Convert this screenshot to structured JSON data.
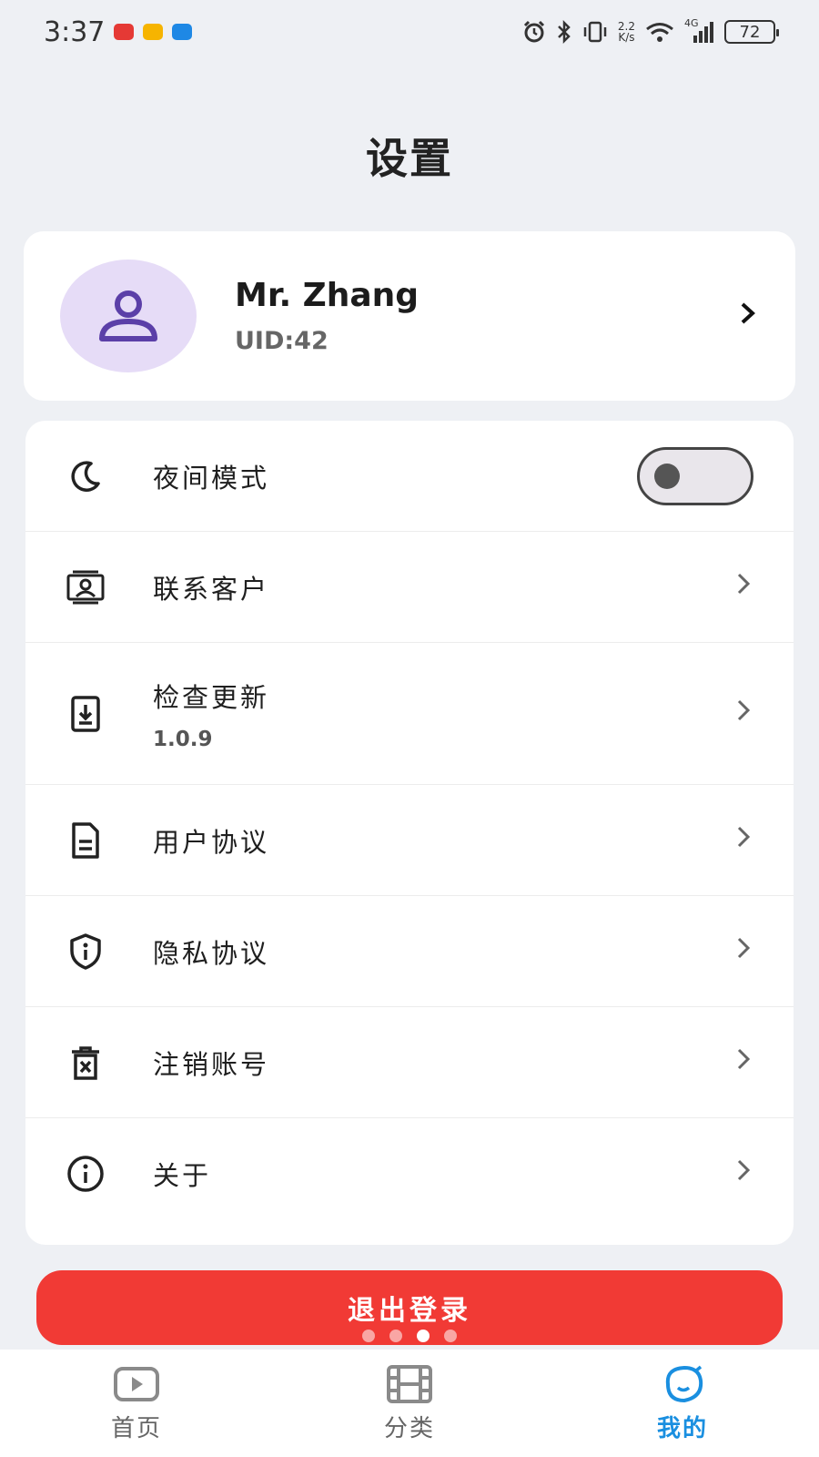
{
  "status_bar": {
    "time": "3:37",
    "net_speed_top": "2.2",
    "net_speed_bottom": "K/s",
    "network_type": "4G",
    "battery": "72",
    "app_icons": [
      "huawei-app-icon",
      "mail-app-icon",
      "message-app-icon"
    ],
    "app_icon_colors": [
      "#e53935",
      "#f6b400",
      "#1e88e5"
    ]
  },
  "page": {
    "title": "设置"
  },
  "profile": {
    "name": "Mr. Zhang",
    "uid": "UID:42",
    "avatar_color": "#e6dcf7",
    "avatar_icon_color": "#5b3fa8"
  },
  "settings": {
    "items": [
      {
        "label": "夜间模式",
        "icon": "moon-icon",
        "control": "toggle",
        "toggle_on": false
      },
      {
        "label": "联系客户",
        "icon": "contact-card-icon",
        "control": "chevron"
      },
      {
        "label": "检查更新",
        "sub": "1.0.9",
        "icon": "download-box-icon",
        "control": "chevron"
      },
      {
        "label": "用户协议",
        "icon": "document-icon",
        "control": "chevron"
      },
      {
        "label": "隐私协议",
        "icon": "shield-info-icon",
        "control": "chevron"
      },
      {
        "label": "注销账号",
        "icon": "delete-account-icon",
        "control": "chevron"
      },
      {
        "label": "关于",
        "icon": "info-circle-icon",
        "control": "chevron"
      }
    ]
  },
  "logout": {
    "label": "退出登录",
    "color": "#f13a35"
  },
  "pager": {
    "count": 4,
    "active_index": 2
  },
  "bottom_nav": {
    "items": [
      {
        "label": "首页",
        "icon": "play-home-icon",
        "active": false
      },
      {
        "label": "分类",
        "icon": "film-category-icon",
        "active": false
      },
      {
        "label": "我的",
        "icon": "face-profile-icon",
        "active": true
      }
    ],
    "active_color": "#1a8fe0"
  }
}
